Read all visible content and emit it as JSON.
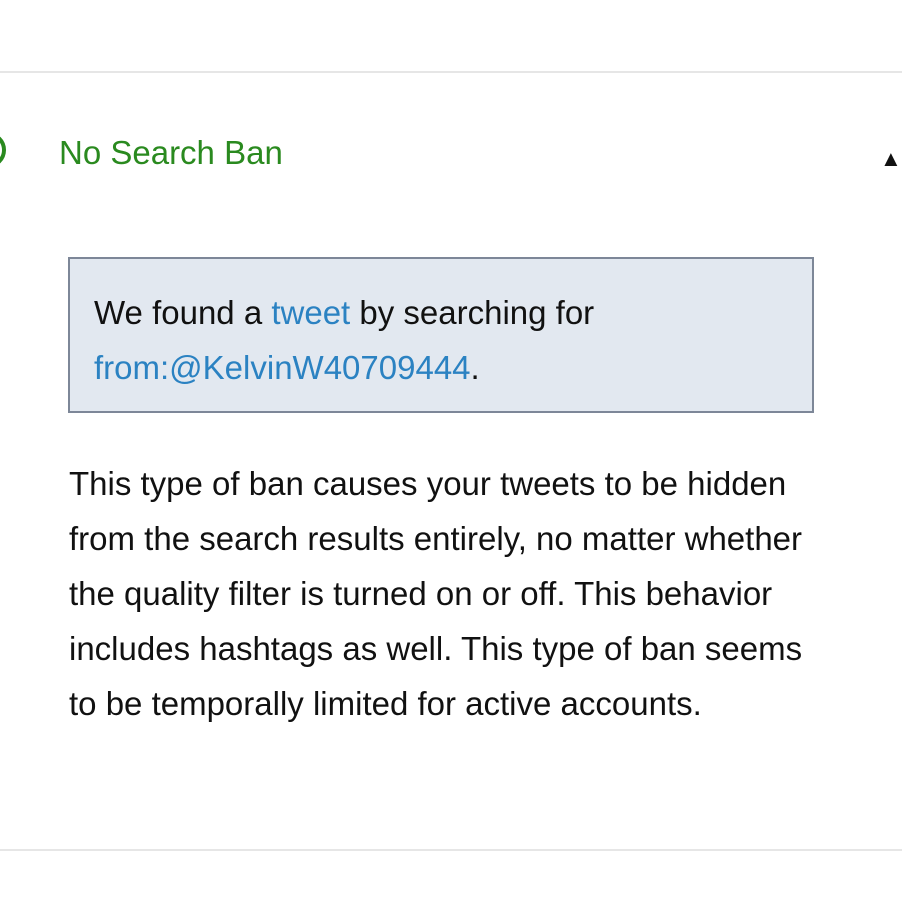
{
  "section": {
    "title": "No Search Ban",
    "toggle_symbol": "▲",
    "status_color": "#2a8a1f",
    "status_icon": "check-circle-icon"
  },
  "result": {
    "text_before_link": "We found a ",
    "link_tweet": "tweet",
    "text_middle": " by searching for ",
    "link_query": "from:@KelvinW40709444",
    "text_after": "."
  },
  "description": "This type of ban causes your tweets to be hidden from the search results entirely, no matter whether the quality filter is turned on or off. This behavior includes hashtags as well. This type of ban seems to be temporally limited for active accounts."
}
